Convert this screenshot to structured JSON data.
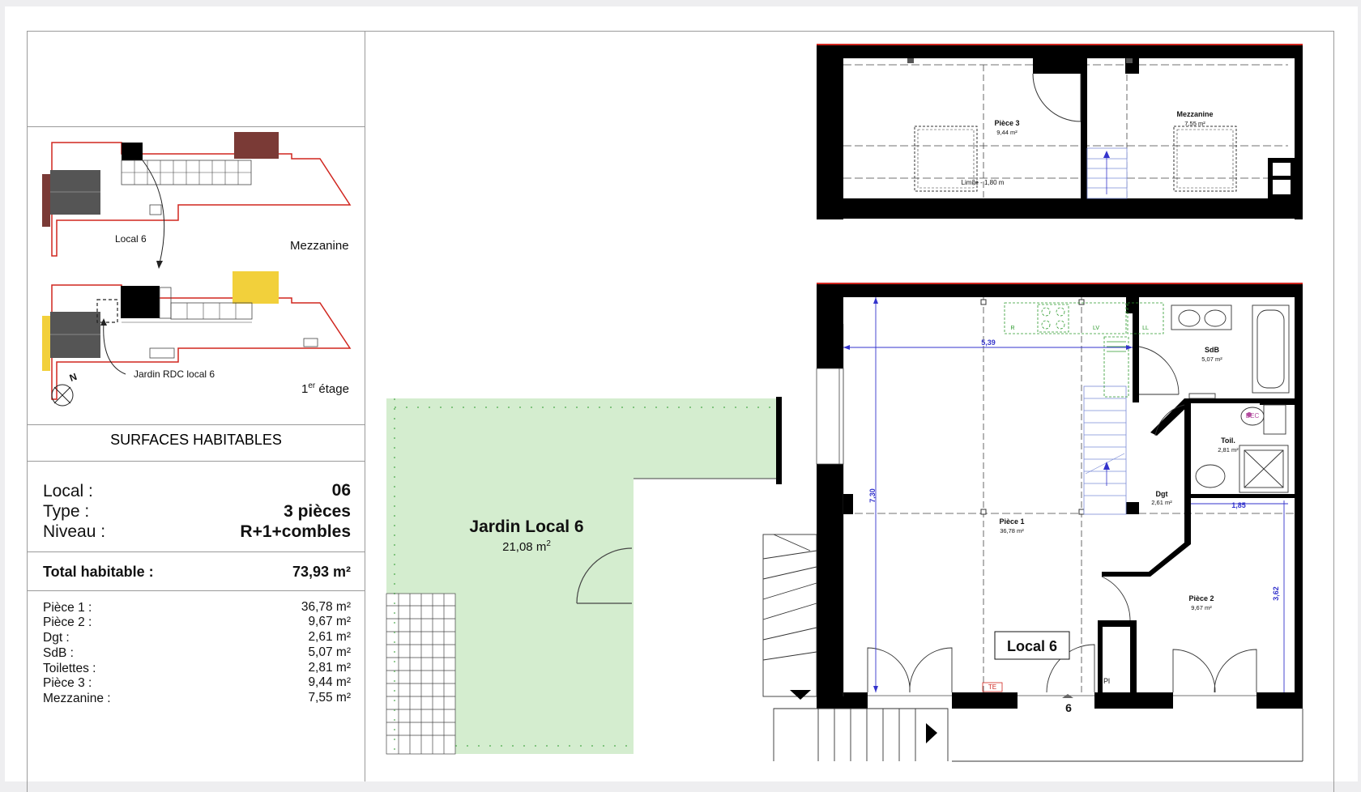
{
  "keyplan": {
    "label_local": "Local 6",
    "label_mezzanine": "Mezzanine",
    "label_jardin": "Jardin RDC local 6",
    "label_etage": "1",
    "label_etage_sup": "er",
    "label_etage_rest": " étage",
    "north": "N"
  },
  "surfaces": {
    "heading": "SURFACES HABITABLES",
    "local_label": "Local :",
    "local_value": "06",
    "type_label": "Type :",
    "type_value": "3 pièces",
    "niveau_label": "Niveau :",
    "niveau_value": "R+1+combles",
    "total_label": "Total habitable :",
    "total_value": "73,93 m²",
    "rooms": [
      {
        "label": "Pièce 1 :",
        "value": "36,78 m²"
      },
      {
        "label": "Pièce 2 :",
        "value": "9,67 m²"
      },
      {
        "label": "Dgt :",
        "value": "2,61 m²"
      },
      {
        "label": "SdB :",
        "value": "5,07 m²"
      },
      {
        "label": "Toilettes :",
        "value": "2,81 m²"
      },
      {
        "label": "Pièce 3 :",
        "value": "9,44 m²"
      },
      {
        "label": "Mezzanine :",
        "value": "7,55 m²"
      }
    ]
  },
  "garden": {
    "title": "Jardin Local 6",
    "area": "21,08 m",
    "area_sup": "2",
    "color": "#d4edcf"
  },
  "mezzanine_plan": {
    "piece3_name": "Pièce 3",
    "piece3_area": "9,44 m²",
    "mezz_name": "Mezzanine",
    "mezz_area": "7,55 m²",
    "limite": "Limite - 1,80 m"
  },
  "main_plan": {
    "local_tag": "Local 6",
    "piece1_name": "Pièce 1",
    "piece1_area": "36,78 m²",
    "piece2_name": "Pièce 2",
    "piece2_area": "9,67 m²",
    "sdb_name": "SdB",
    "sdb_area": "5,07 m²",
    "toil_name": "Toil.",
    "toil_area": "2,81 m²",
    "dgt_name": "Dgt",
    "dgt_area": "2,61 m²",
    "dim_width": "5,39",
    "dim_height": "7,30",
    "dim_185": "1,85",
    "dim_362": "3,62",
    "te": "TE",
    "pl": "Pl",
    "bec": "BEC",
    "entry_number": "6",
    "fixture_r": "R",
    "fixture_lv": "LV",
    "fixture_ll": "LL"
  },
  "colors": {
    "wall": "#000000",
    "outline_red": "#d0261f",
    "dimension_blue": "#3333cc",
    "fixture_green": "#2d9a2d",
    "keyplan_yellow": "#f2d03b",
    "keyplan_brown": "#7a3a36"
  }
}
